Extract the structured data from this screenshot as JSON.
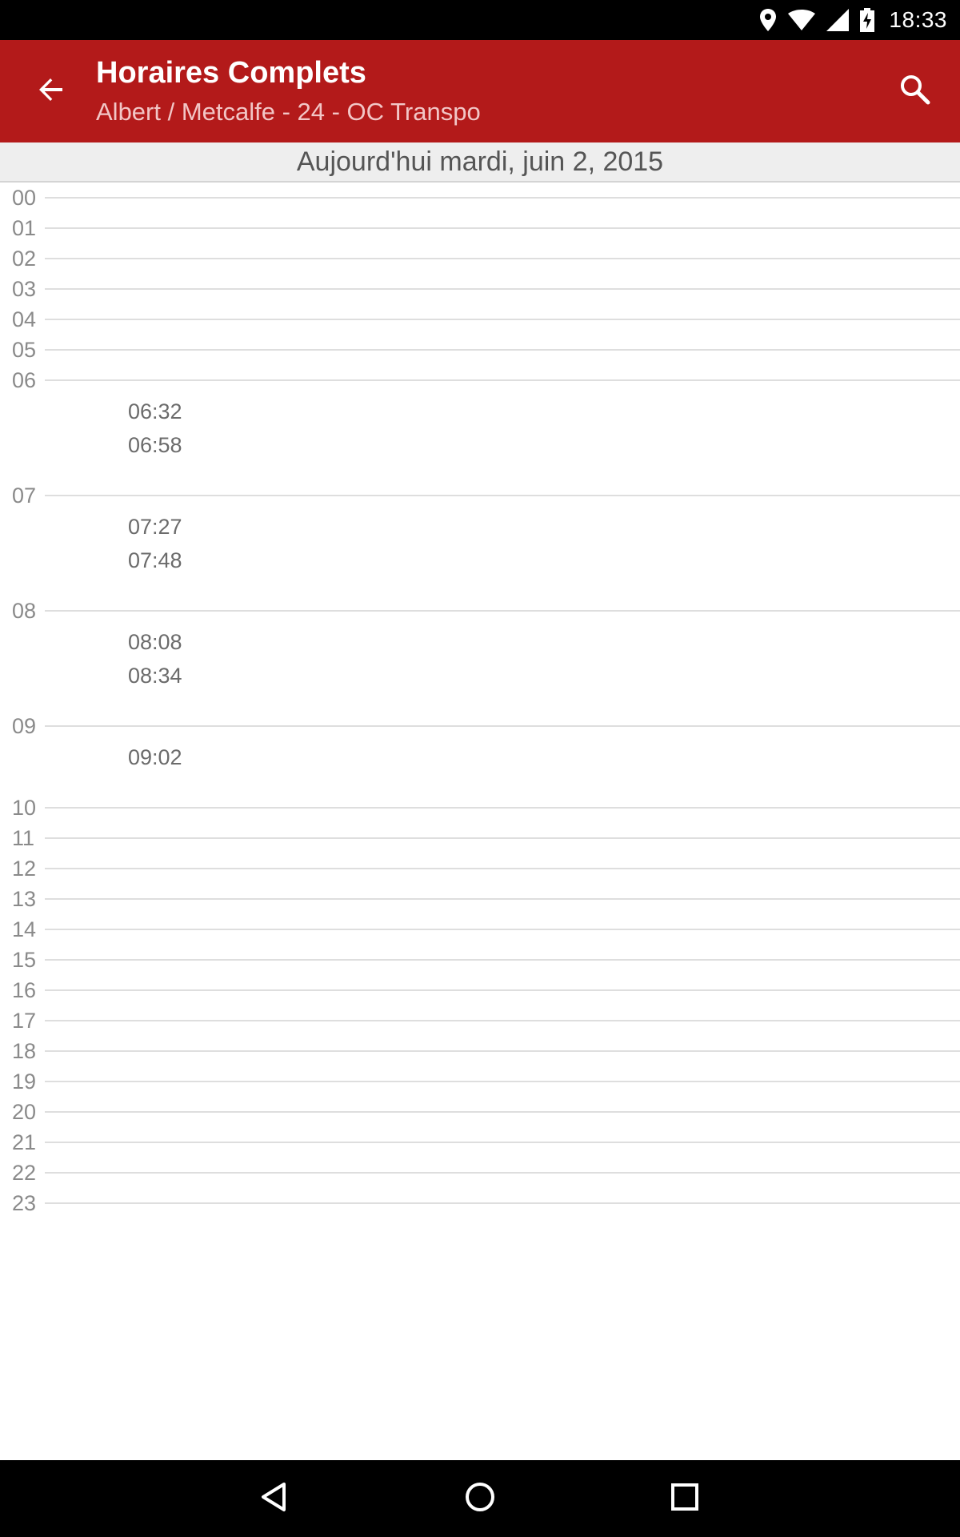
{
  "status_bar": {
    "time": "18:33",
    "icons": [
      "location-icon",
      "wifi-icon",
      "signal-icon",
      "battery-charging-icon"
    ]
  },
  "app_bar": {
    "title": "Horaires Complets",
    "subtitle": "Albert / Metcalfe - 24 - OC Transpo",
    "back_icon": "arrow-back-icon",
    "search_icon": "search-icon",
    "color": "#b31a1a"
  },
  "date_header": "Aujourd'hui mardi, juin 2, 2015",
  "schedule": {
    "hours": [
      "00",
      "01",
      "02",
      "03",
      "04",
      "05",
      "06",
      "07",
      "08",
      "09",
      "10",
      "11",
      "12",
      "13",
      "14",
      "15",
      "16",
      "17",
      "18",
      "19",
      "20",
      "21",
      "22",
      "23"
    ],
    "departures": {
      "06": [
        "06:32",
        "06:58"
      ],
      "07": [
        "07:27",
        "07:48"
      ],
      "08": [
        "08:08",
        "08:34"
      ],
      "09": [
        "09:02"
      ]
    }
  },
  "nav_bar": {
    "icons": [
      "back-triangle-icon",
      "home-circle-icon",
      "recents-square-icon"
    ]
  }
}
